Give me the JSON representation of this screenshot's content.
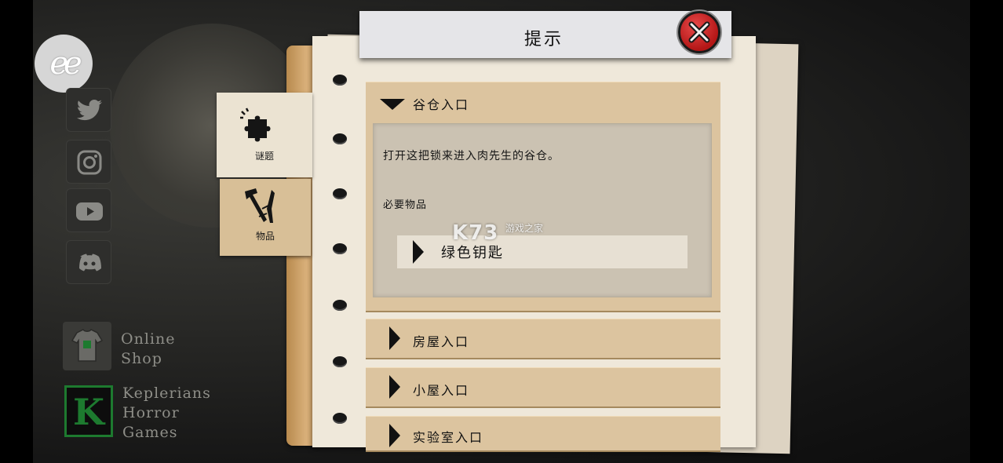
{
  "header": {
    "title": "提示"
  },
  "tabs": [
    {
      "label": "谜题",
      "icon": "puzzle-icon"
    },
    {
      "label": "物品",
      "icon": "tools-icon"
    }
  ],
  "sections": [
    {
      "label": "谷仓入口",
      "expanded": true,
      "description": "打开这把锁来进入肉先生的谷仓。",
      "required_label": "必要物品",
      "items": [
        "绿色钥匙"
      ]
    },
    {
      "label": "房屋入口",
      "expanded": false
    },
    {
      "label": "小屋入口",
      "expanded": false
    },
    {
      "label": "实验室入口",
      "expanded": false
    }
  ],
  "social": {
    "logo_text": "ee",
    "icons": [
      "twitter-icon",
      "instagram-icon",
      "youtube-icon",
      "discord-icon"
    ],
    "shop_lines": [
      "Online",
      "Shop"
    ],
    "keplerians_lines": [
      "Keplerians",
      "Horror",
      "Games"
    ],
    "keplerians_logo_letter": "K"
  },
  "watermark": {
    "main": "K73",
    "sub": "游戏之家"
  },
  "colors": {
    "close_red": "#c91f1f",
    "keplerians_green": "#1d7a2f",
    "section_tan": "#dcc49f"
  }
}
